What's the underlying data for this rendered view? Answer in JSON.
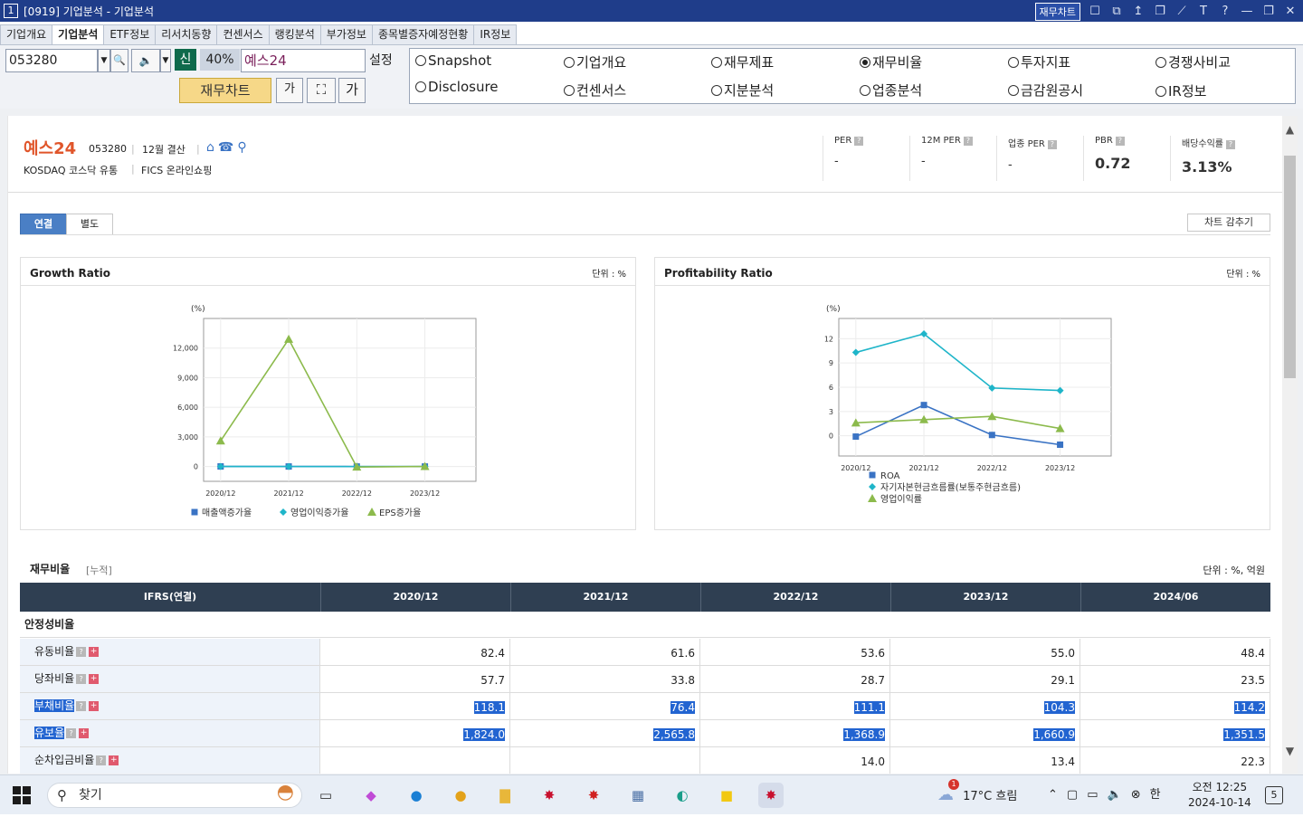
{
  "titlebar": {
    "number": "1",
    "title": "[0919] 기업분석 - 기업분석",
    "fin_chart_button": "재무차트",
    "icons": [
      "doc-icon",
      "window-icon",
      "arrow-up-icon",
      "copy-icon",
      "crop-icon",
      "font-icon",
      "help-icon",
      "minimize-icon",
      "restore-icon",
      "close-icon"
    ],
    "icon_glyphs": [
      "☐",
      "⧉",
      "↥",
      "❐",
      "⟋",
      "T",
      "?",
      "—",
      "❐",
      "✕"
    ]
  },
  "menu_tabs": [
    "기업개요",
    "기업분석",
    "ETF정보",
    "리서치동향",
    "컨센서스",
    "랭킹분석",
    "부가정보",
    "종목별증자예정현황",
    "IR정보"
  ],
  "active_tab": "기업분석",
  "toolbar": {
    "code": "053280",
    "new_badge": "신",
    "percent": "40%",
    "stock_name": "예스24",
    "settings_label": "설정",
    "fin_chart_label": "재무차트",
    "font_button": "가",
    "dropdown_glyph": "▼",
    "search_glyph": "🔍",
    "speaker_glyph": "🔈",
    "fit_glyph": "⛶"
  },
  "radio_options": [
    {
      "label": "Snapshot",
      "selected": false
    },
    {
      "label": "기업개요",
      "selected": false
    },
    {
      "label": "재무제표",
      "selected": false
    },
    {
      "label": "재무비율",
      "selected": true
    },
    {
      "label": "투자지표",
      "selected": false
    },
    {
      "label": "경쟁사비교",
      "selected": false
    },
    {
      "label": "Disclosure",
      "selected": false
    },
    {
      "label": "컨센서스",
      "selected": false
    },
    {
      "label": "지분분석",
      "selected": false
    },
    {
      "label": "업종분석",
      "selected": false
    },
    {
      "label": "금감원공시",
      "selected": false
    },
    {
      "label": "IR정보",
      "selected": false
    }
  ],
  "company": {
    "name": "예스24",
    "code": "053280",
    "settlement": "12월 결산",
    "market": "KOSDAQ  코스닥 유통",
    "fics": "FICS 온라인쇼핑",
    "separator": "|",
    "icon_glyphs": [
      "⌂",
      "☎",
      "⚲"
    ]
  },
  "metrics": [
    {
      "label": "PER",
      "value": "-"
    },
    {
      "label": "12M PER",
      "value": "-"
    },
    {
      "label": "업종 PER",
      "value": "-"
    },
    {
      "label": "PBR",
      "value": "0.72"
    },
    {
      "label": "배당수익률",
      "value": "3.13%"
    }
  ],
  "question_glyph": "?",
  "plus_glyph": "+",
  "sub_tabs": [
    "연결",
    "별도"
  ],
  "hide_chart_label": "차트 감추기",
  "growth_panel": {
    "title": "Growth Ratio",
    "unit": "단위 : %"
  },
  "profit_panel": {
    "title": "Profitability Ratio",
    "unit": "단위 : %"
  },
  "chart_data": [
    {
      "type": "line",
      "title": "Growth Ratio",
      "ylabel": "(%)",
      "categories": [
        "2020/12",
        "2021/12",
        "2022/12",
        "2023/12"
      ],
      "ylim": [
        -1500,
        15000
      ],
      "yticks": [
        0,
        3000,
        6000,
        9000,
        12000
      ],
      "ytick_labels": [
        "0",
        "3,000",
        "6,000",
        "9,000",
        "12,000"
      ],
      "series": [
        {
          "name": "매출액증가율",
          "color": "#3a73c4",
          "marker": "square",
          "values": [
            10,
            5,
            2,
            1
          ]
        },
        {
          "name": "영업이익증가율",
          "color": "#1fb5c9",
          "marker": "diamond",
          "values": [
            5,
            2,
            2,
            0
          ]
        },
        {
          "name": "EPS증가율",
          "color": "#8cba4c",
          "marker": "triangle",
          "values": [
            2600,
            12900,
            -50,
            10
          ]
        }
      ]
    },
    {
      "type": "line",
      "title": "Profitability Ratio",
      "ylabel": "(%)",
      "categories": [
        "2020/12",
        "2021/12",
        "2022/12",
        "2023/12"
      ],
      "ylim": [
        -2.5,
        14.5
      ],
      "yticks": [
        0,
        3,
        6,
        9,
        12
      ],
      "ytick_labels": [
        "0",
        "3",
        "6",
        "9",
        "12"
      ],
      "series": [
        {
          "name": "ROA",
          "color": "#3a73c4",
          "marker": "square",
          "values": [
            -0.1,
            3.8,
            0.1,
            -1.1
          ]
        },
        {
          "name": "자기자본현금흐름률(보통주현금흐름)",
          "color": "#1fb5c9",
          "marker": "diamond",
          "values": [
            10.3,
            12.6,
            5.9,
            5.6
          ]
        },
        {
          "name": "영업이익률",
          "color": "#8cba4c",
          "marker": "triangle",
          "values": [
            1.6,
            2.0,
            2.4,
            0.9
          ]
        }
      ]
    }
  ],
  "table": {
    "title": "재무비율",
    "subtitle": "[누적]",
    "unit": "단위 : %, 억원",
    "header": [
      "IFRS(연결)",
      "2020/12",
      "2021/12",
      "2022/12",
      "2023/12",
      "2024/06"
    ],
    "section": "안정성비율",
    "rows": [
      {
        "label": "유동비율",
        "values": [
          "82.4",
          "61.6",
          "53.6",
          "55.0",
          "48.4"
        ],
        "highlight": false,
        "indent": false
      },
      {
        "label": "당좌비율",
        "values": [
          "57.7",
          "33.8",
          "28.7",
          "29.1",
          "23.5"
        ],
        "highlight": false,
        "indent": false
      },
      {
        "label": "부채비율",
        "values": [
          "118.1",
          "76.4",
          "111.1",
          "104.3",
          "114.2"
        ],
        "highlight": true,
        "indent": false
      },
      {
        "label": "유보율",
        "values": [
          "1,824.0",
          "2,565.8",
          "1,368.9",
          "1,660.9",
          "1,351.5"
        ],
        "highlight": true,
        "indent": false
      },
      {
        "label": "순차입금비율",
        "values": [
          "",
          "",
          "14.0",
          "13.4",
          "22.3"
        ],
        "highlight": false,
        "indent": true
      }
    ]
  },
  "taskbar": {
    "search_label": "찾기",
    "search_glyph": "⚲",
    "weather_badge": "1",
    "weather": "17°C  흐림",
    "ime": "한",
    "time": "오전 12:25",
    "date": "2024-10-14",
    "notification_count": "5",
    "tray_glyphs": [
      "⌃",
      "▢",
      "▭",
      "🔈",
      "⊗"
    ],
    "apps": [
      {
        "name": "task-view-icon",
        "glyph": "▭",
        "color": "#333"
      },
      {
        "name": "copilot-icon",
        "glyph": "◆",
        "color": "#c04bd6"
      },
      {
        "name": "edge-icon",
        "glyph": "●",
        "color": "#1a7fd4"
      },
      {
        "name": "chrome-icon",
        "glyph": "●",
        "color": "#e3a21a"
      },
      {
        "name": "file-explorer-icon",
        "glyph": "▇",
        "color": "#e8b73a"
      },
      {
        "name": "trading-app-icon",
        "glyph": "✸",
        "color": "#c8102e"
      },
      {
        "name": "trading-app2-icon",
        "glyph": "✸",
        "color": "#d02020"
      },
      {
        "name": "calculator-icon",
        "glyph": "▦",
        "color": "#4a6fa5"
      },
      {
        "name": "browser-icon",
        "glyph": "◐",
        "color": "#1a9e8a"
      },
      {
        "name": "sticky-notes-icon",
        "glyph": "■",
        "color": "#f2c811"
      },
      {
        "name": "trading-app3-icon",
        "glyph": "✸",
        "color": "#c8102e"
      }
    ]
  }
}
